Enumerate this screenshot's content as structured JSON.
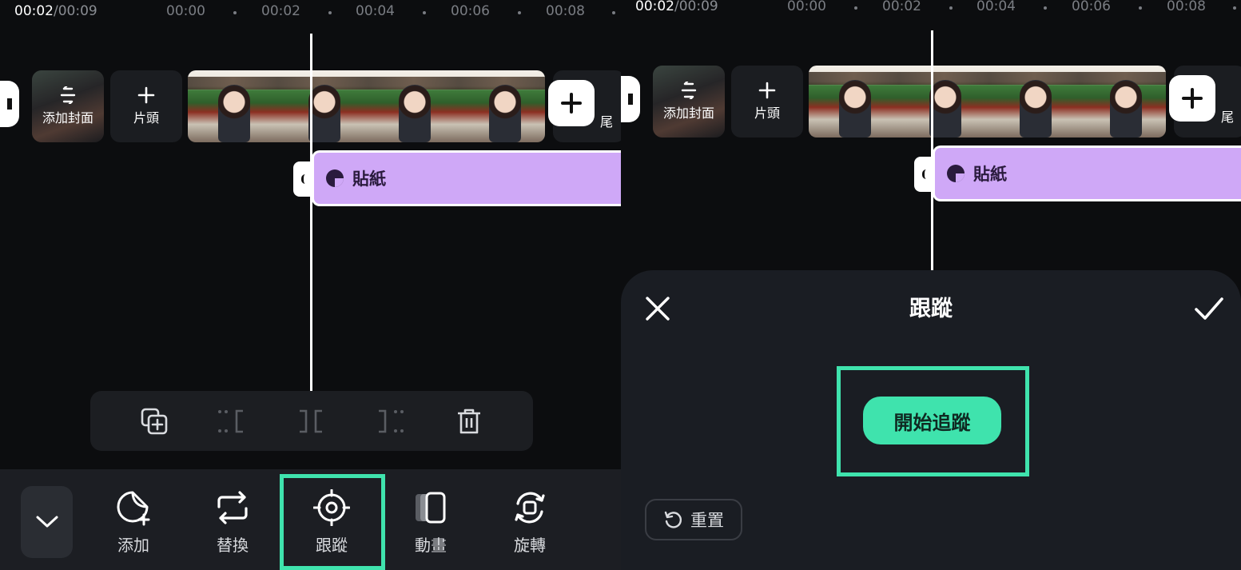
{
  "left": {
    "ruler": {
      "current": "00:02",
      "total": "/00:09",
      "ticks": [
        "00:00",
        "00:02",
        "00:04",
        "00:06",
        "00:08"
      ]
    },
    "cover_tile": {
      "label": "添加封面",
      "icon": "swap-vertical-icon"
    },
    "intro_tile": {
      "label": "片頭",
      "icon": "plus-icon"
    },
    "outro_tile": {
      "label": "尾"
    },
    "sticker": {
      "label": "貼紙",
      "icon": "sticker-icon"
    },
    "edit_toolbar": {
      "icons": [
        "duplicate-icon",
        "split-left-icon",
        "split-icon",
        "split-right-icon",
        "delete-icon"
      ]
    },
    "bottom_tools": [
      {
        "label": "添加",
        "icon": "sticker-add-icon"
      },
      {
        "label": "替換",
        "icon": "replace-icon"
      },
      {
        "label": "跟蹤",
        "icon": "track-target-icon"
      },
      {
        "label": "動畫",
        "icon": "animation-icon"
      },
      {
        "label": "旋轉",
        "icon": "rotate-icon"
      }
    ],
    "highlight_color": "#3fe3ad"
  },
  "right": {
    "ruler": {
      "current": "00:02",
      "total": "/00:09",
      "ticks": [
        "00:00",
        "00:02",
        "00:04",
        "00:06",
        "00:08"
      ]
    },
    "cover_tile": {
      "label": "添加封面"
    },
    "intro_tile": {
      "label": "片頭"
    },
    "outro_tile": {
      "label": "尾"
    },
    "sticker": {
      "label": "貼紙"
    },
    "sheet": {
      "title": "跟蹤",
      "start_button": "開始追蹤",
      "reset_button": "重置"
    }
  }
}
